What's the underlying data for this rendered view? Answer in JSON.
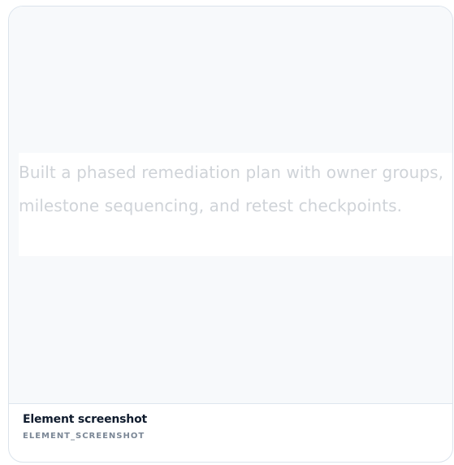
{
  "preview": {
    "text": "Built a phased remediation plan with owner groups, milestone sequencing, and retest checkpoints."
  },
  "caption": {
    "title": "Element screenshot",
    "subtitle": "ELEMENT_SCREENSHOT"
  }
}
